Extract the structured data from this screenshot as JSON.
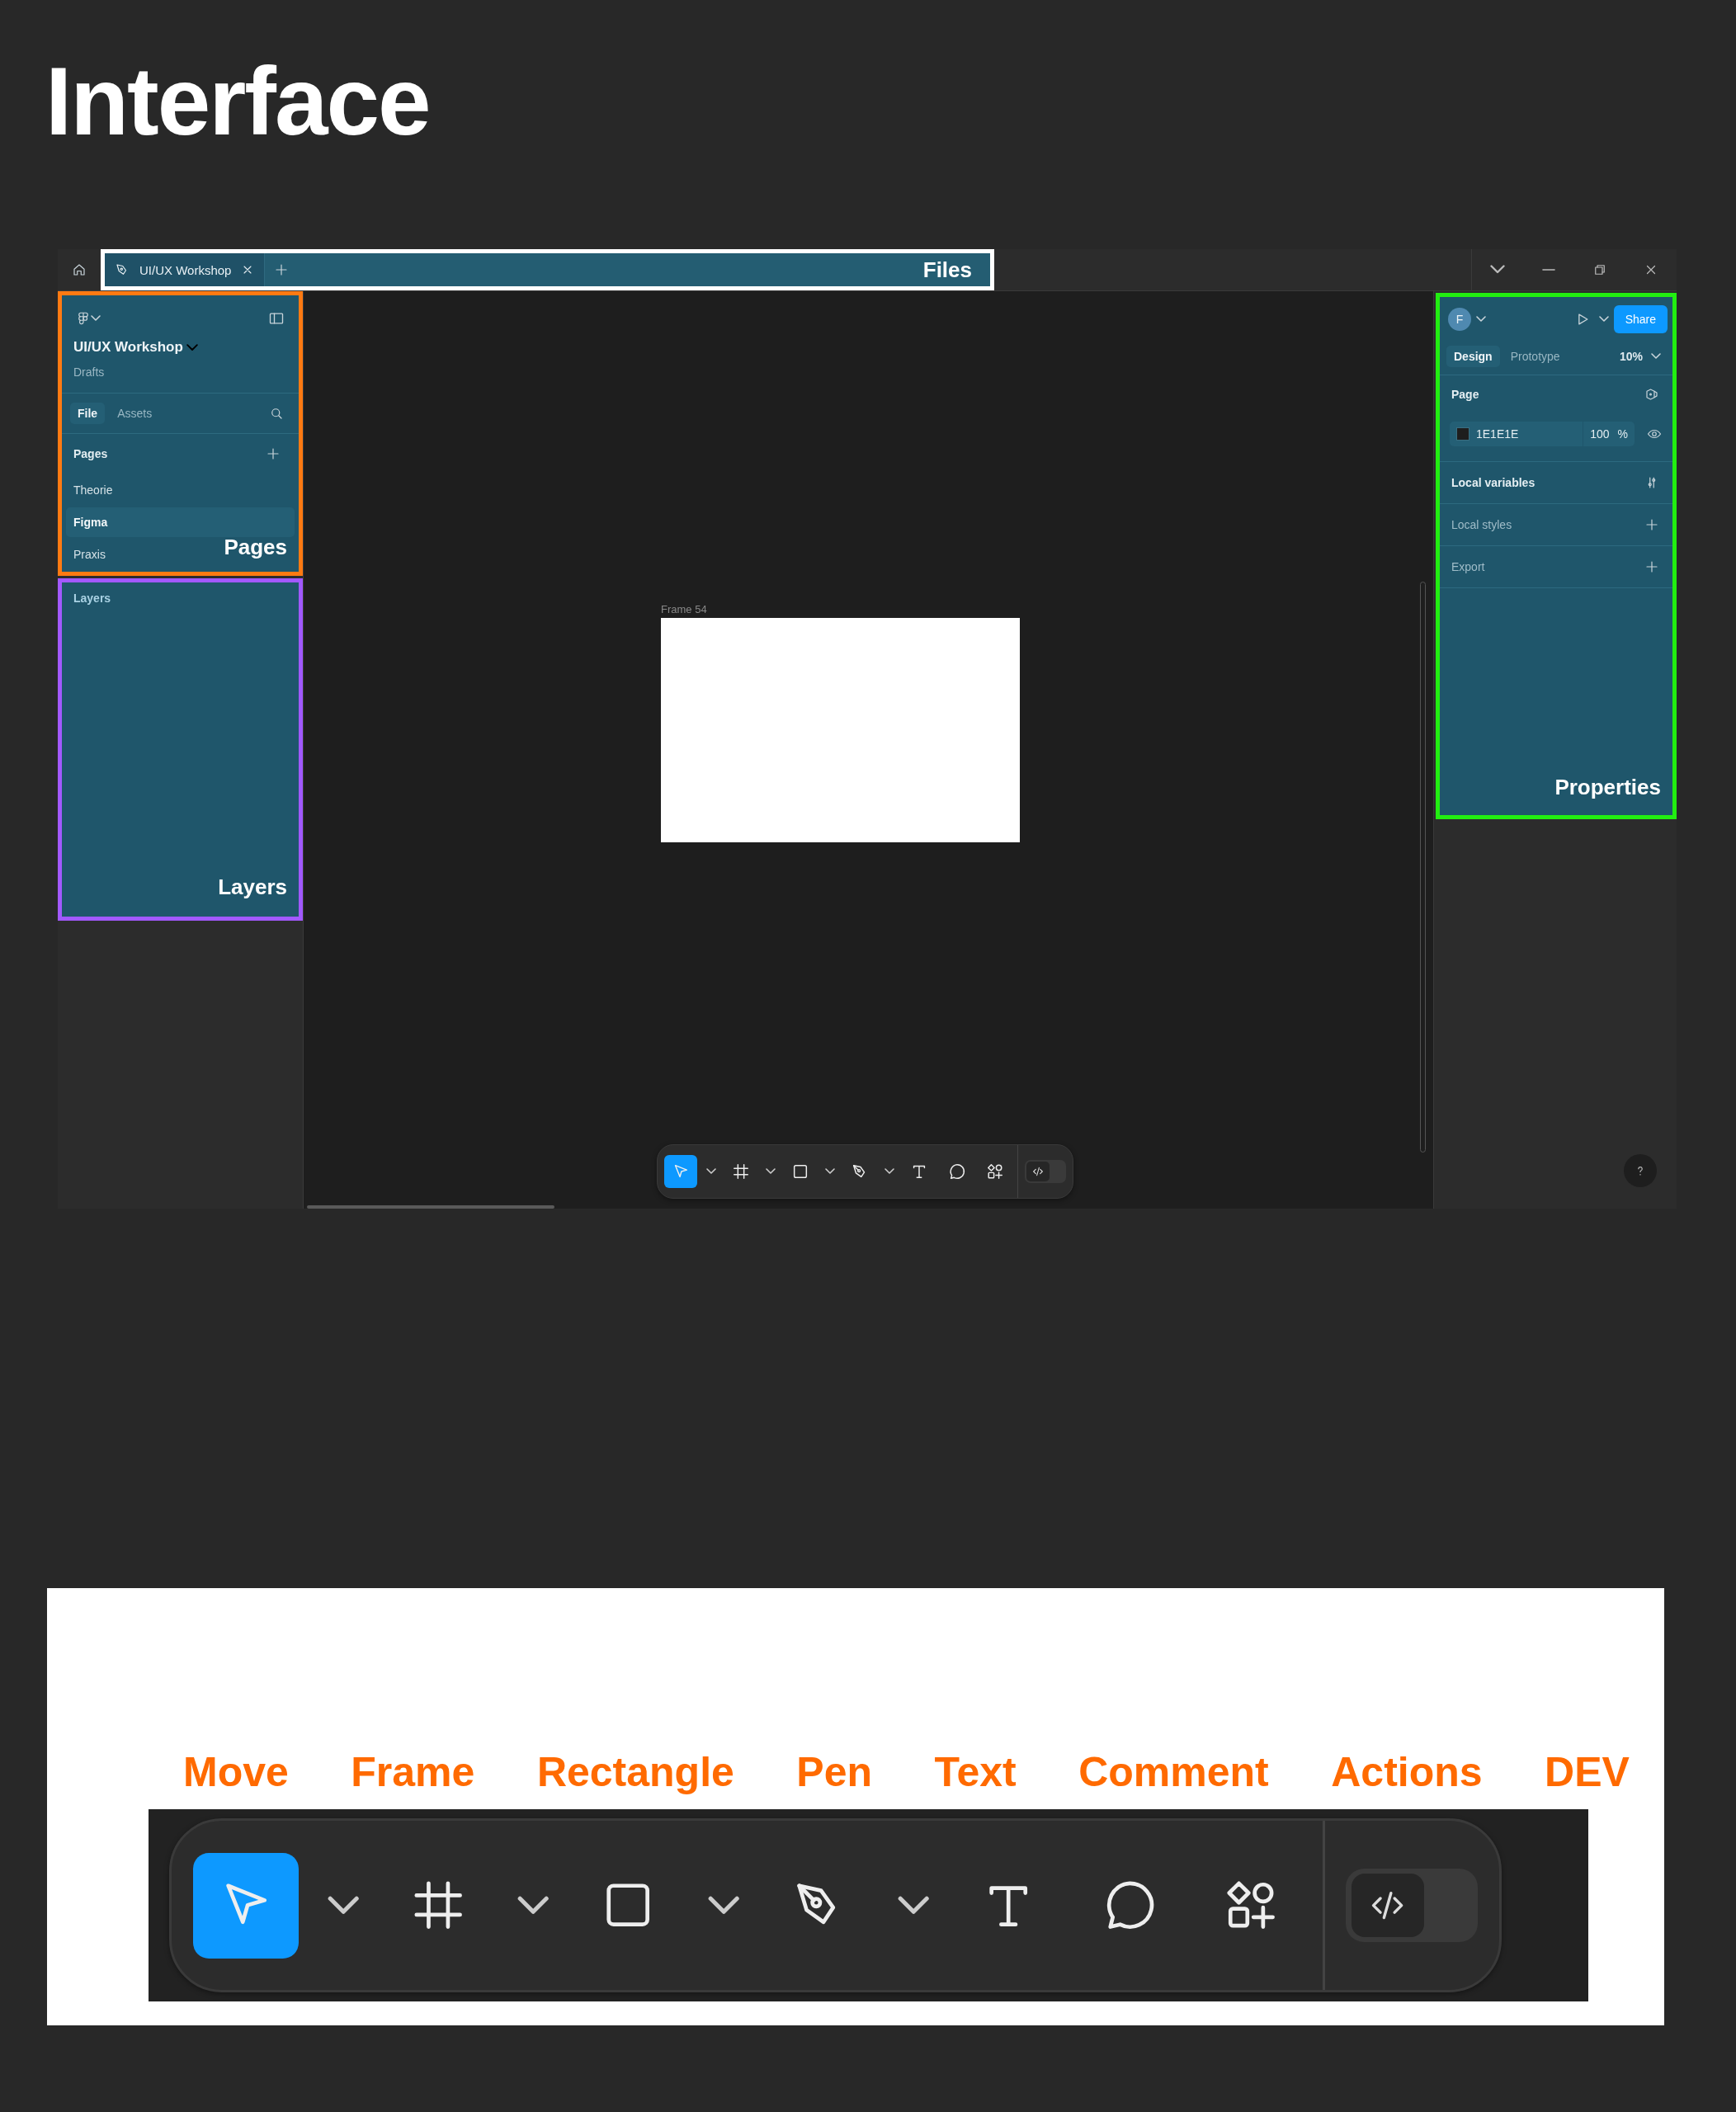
{
  "heading": "Interface",
  "window": {
    "tab_bar": {
      "tabs": [
        {
          "label": "UI/UX Workshop",
          "selected": true
        }
      ],
      "callout": "Files"
    },
    "left_panel": {
      "file_name": "UI/UX Workshop",
      "location": "Drafts",
      "tabs": [
        {
          "label": "File",
          "selected": true
        },
        {
          "label": "Assets",
          "selected": false
        }
      ],
      "pages_heading": "Pages",
      "pages": [
        {
          "label": "Theorie",
          "selected": false
        },
        {
          "label": "Figma",
          "selected": true
        },
        {
          "label": "Praxis",
          "selected": false
        }
      ],
      "pages_callout": "Pages",
      "layers_heading": "Layers",
      "layers_callout": "Layers"
    },
    "canvas": {
      "frame_label": "Frame 54",
      "toolbar": {
        "tools": [
          {
            "kind": "move",
            "selected": true,
            "menu": true
          },
          {
            "kind": "frame",
            "selected": false,
            "menu": true
          },
          {
            "kind": "rectangle",
            "selected": false,
            "menu": true
          },
          {
            "kind": "pen",
            "selected": false,
            "menu": true
          },
          {
            "kind": "text",
            "selected": false,
            "menu": false
          },
          {
            "kind": "comment",
            "selected": false,
            "menu": false
          },
          {
            "kind": "actions",
            "selected": false,
            "menu": false
          }
        ],
        "dev_mode": false
      }
    },
    "right_panel": {
      "avatar": "F",
      "share": "Share",
      "tabs": [
        {
          "label": "Design",
          "selected": true
        },
        {
          "label": "Prototype",
          "selected": false
        }
      ],
      "zoom": "10%",
      "page_heading": "Page",
      "page_color": "1E1E1E",
      "page_opacity": "100",
      "opacity_unit": "%",
      "sections": [
        {
          "label": "Local variables",
          "kind": "variables"
        },
        {
          "label": "Local styles",
          "kind": "add"
        },
        {
          "label": "Export",
          "kind": "add"
        }
      ],
      "callout": "Properties"
    }
  },
  "legend": {
    "labels": [
      "Move",
      "Frame",
      "Rectangle",
      "Pen",
      "Text",
      "Comment",
      "Actions",
      "DEV"
    ],
    "toolbar": {
      "tools": [
        {
          "kind": "move",
          "selected": true,
          "menu": true
        },
        {
          "kind": "frame",
          "selected": false,
          "menu": true
        },
        {
          "kind": "rectangle",
          "selected": false,
          "menu": true
        },
        {
          "kind": "pen",
          "selected": false,
          "menu": true
        },
        {
          "kind": "text",
          "selected": false,
          "menu": false
        },
        {
          "kind": "comment",
          "selected": false,
          "menu": false
        },
        {
          "kind": "actions",
          "selected": false,
          "menu": false
        }
      ],
      "dev_mode": false
    }
  }
}
